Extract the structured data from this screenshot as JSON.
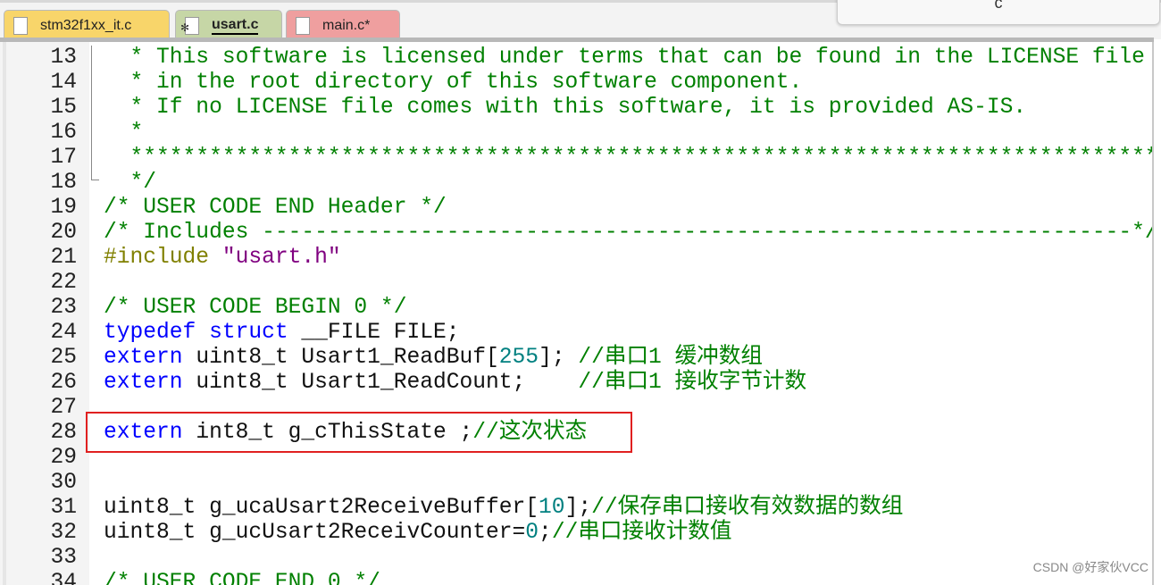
{
  "tabs": [
    {
      "label": "stm32f1xx_it.c",
      "color": "#f8d56a"
    },
    {
      "label": "usart.c",
      "color": "#c6d6a6",
      "active": true
    },
    {
      "label": "main.c*",
      "color": "#ef9f9f"
    }
  ],
  "popup_text": "c",
  "highlight_color": "#e02020",
  "watermark": "CSDN @好家伙VCC",
  "lines": [
    {
      "n": "13",
      "t": [
        [
          "cm",
          "  * This software is licensed under terms that can be found in the LICENSE file"
        ]
      ]
    },
    {
      "n": "14",
      "t": [
        [
          "cm",
          "  * in the root directory of this software component."
        ]
      ]
    },
    {
      "n": "15",
      "t": [
        [
          "cm",
          "  * If no LICENSE file comes with this software, it is provided AS-IS."
        ]
      ]
    },
    {
      "n": "16",
      "t": [
        [
          "cm",
          "  *"
        ]
      ]
    },
    {
      "n": "17",
      "t": [
        [
          "cm",
          "  ******************************************************************************"
        ]
      ]
    },
    {
      "n": "18",
      "t": [
        [
          "cm",
          "  */"
        ]
      ]
    },
    {
      "n": "19",
      "t": [
        [
          "cm",
          "/* USER CODE END Header */"
        ]
      ]
    },
    {
      "n": "20",
      "t": [
        [
          "cm",
          "/* Includes ------------------------------------------------------------------*/"
        ]
      ]
    },
    {
      "n": "21",
      "t": [
        [
          "pp",
          "#include "
        ],
        [
          "str",
          "\"usart.h\""
        ]
      ]
    },
    {
      "n": "22",
      "t": []
    },
    {
      "n": "23",
      "t": [
        [
          "cm",
          "/* USER CODE BEGIN 0 */"
        ]
      ]
    },
    {
      "n": "24",
      "t": [
        [
          "kw",
          "typedef"
        ],
        [
          "tx",
          " "
        ],
        [
          "kw",
          "struct"
        ],
        [
          "tx",
          " __FILE FILE;"
        ]
      ]
    },
    {
      "n": "25",
      "t": [
        [
          "kw",
          "extern"
        ],
        [
          "tx",
          " uint8_t Usart1_ReadBuf["
        ],
        [
          "num",
          "255"
        ],
        [
          "tx",
          "]; "
        ],
        [
          "cm",
          "//串口1 缓冲数组"
        ]
      ]
    },
    {
      "n": "26",
      "t": [
        [
          "kw",
          "extern"
        ],
        [
          "tx",
          " uint8_t Usart1_ReadCount;    "
        ],
        [
          "cm",
          "//串口1 接收字节计数"
        ]
      ]
    },
    {
      "n": "27",
      "t": []
    },
    {
      "n": "28",
      "t": [
        [
          "kw",
          "extern"
        ],
        [
          "tx",
          " int8_t g_cThisState ;"
        ],
        [
          "cm",
          "//这次状态"
        ]
      ]
    },
    {
      "n": "29",
      "t": []
    },
    {
      "n": "30",
      "t": []
    },
    {
      "n": "31",
      "t": [
        [
          "tx",
          "uint8_t g_ucaUsart2ReceiveBuffer["
        ],
        [
          "num",
          "10"
        ],
        [
          "tx",
          "];"
        ],
        [
          "cm",
          "//保存串口接收有效数据的数组"
        ]
      ]
    },
    {
      "n": "32",
      "t": [
        [
          "tx",
          "uint8_t g_ucUsart2ReceivCounter="
        ],
        [
          "num",
          "0"
        ],
        [
          "tx",
          ";"
        ],
        [
          "cm",
          "//串口接收计数值"
        ]
      ]
    },
    {
      "n": "33",
      "t": []
    },
    {
      "n": "34",
      "t": [
        [
          "cm",
          "/* USER CODE END 0 */"
        ]
      ]
    }
  ]
}
